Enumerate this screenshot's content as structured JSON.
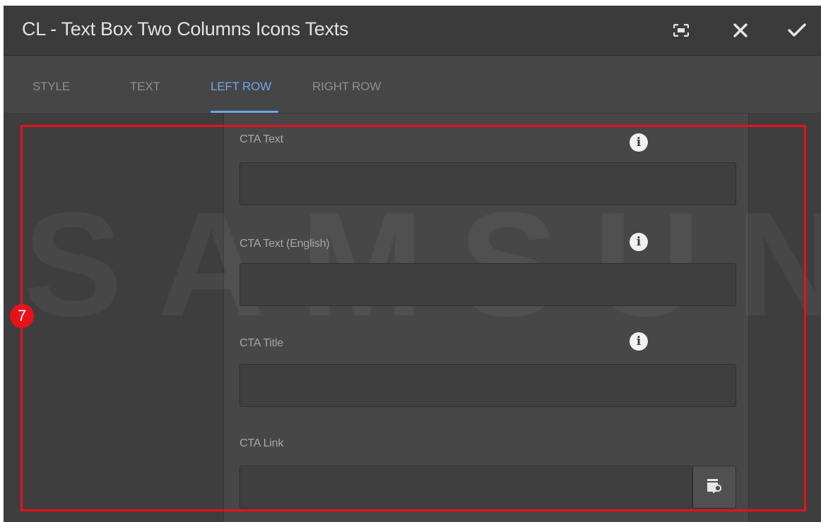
{
  "dialog": {
    "title": "CL - Text Box Two Columns Icons Texts",
    "icons": [
      "fullscreen-icon",
      "close-icon",
      "checkmark-icon"
    ]
  },
  "tabs": [
    {
      "label": "STYLE",
      "active": false
    },
    {
      "label": "TEXT",
      "active": false
    },
    {
      "label": "LEFT ROW",
      "active": true
    },
    {
      "label": "RIGHT ROW",
      "active": false
    }
  ],
  "fields": [
    {
      "label": "CTA Text",
      "value": "",
      "has_info": true
    },
    {
      "label": "CTA Text (English)",
      "value": "",
      "has_info": true
    },
    {
      "label": "CTA Title",
      "value": "",
      "has_info": true
    },
    {
      "label": "CTA Link",
      "value": "",
      "has_browse": true
    }
  ],
  "watermark": "SAMSUNG",
  "annotation": {
    "step": "7",
    "color": "#e8111b"
  },
  "colors": {
    "accent": "#6ea6ea",
    "highlight": "#e8111b",
    "background": "#464646"
  }
}
